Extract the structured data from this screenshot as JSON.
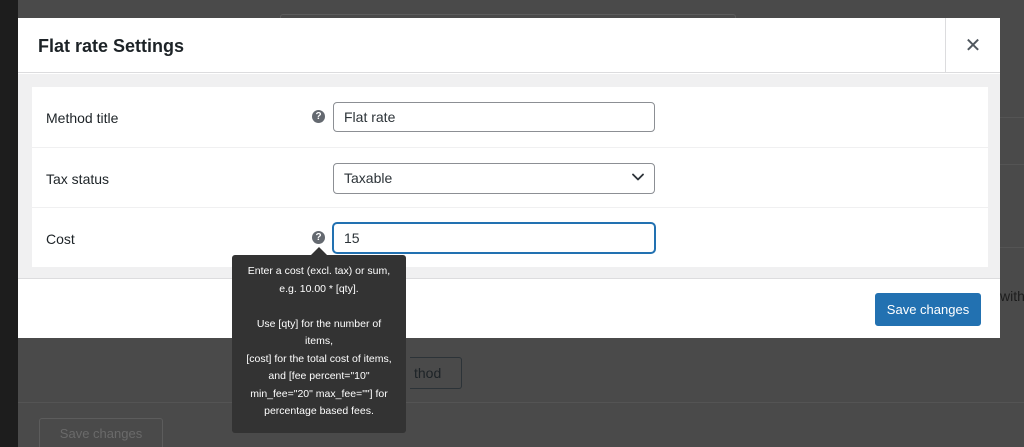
{
  "modal": {
    "title": "Flat rate Settings",
    "close_glyph": "✕"
  },
  "fields": {
    "method_title": {
      "label": "Method title",
      "value": "Flat rate"
    },
    "tax_status": {
      "label": "Tax status",
      "value": "Taxable"
    },
    "cost": {
      "label": "Cost",
      "value": "15"
    }
  },
  "help_glyph": "?",
  "tooltip": {
    "text": "Enter a cost (excl. tax) or sum,\ne.g. 10.00 * [qty].\n\nUse [qty] for the number of\nitems,\n[cost] for the total cost of items,\nand [fee percent=\"10\"\nmin_fee=\"20\" max_fee=\"\"] for\npercentage based fees."
  },
  "footer": {
    "save_label": "Save changes"
  },
  "background": {
    "side_text": "with",
    "method_button_fragment": "thod",
    "save_label": "Save changes"
  },
  "colors": {
    "primary": "#2271b1",
    "tooltip_bg": "#333333",
    "overlay": "#4a4a4a"
  }
}
